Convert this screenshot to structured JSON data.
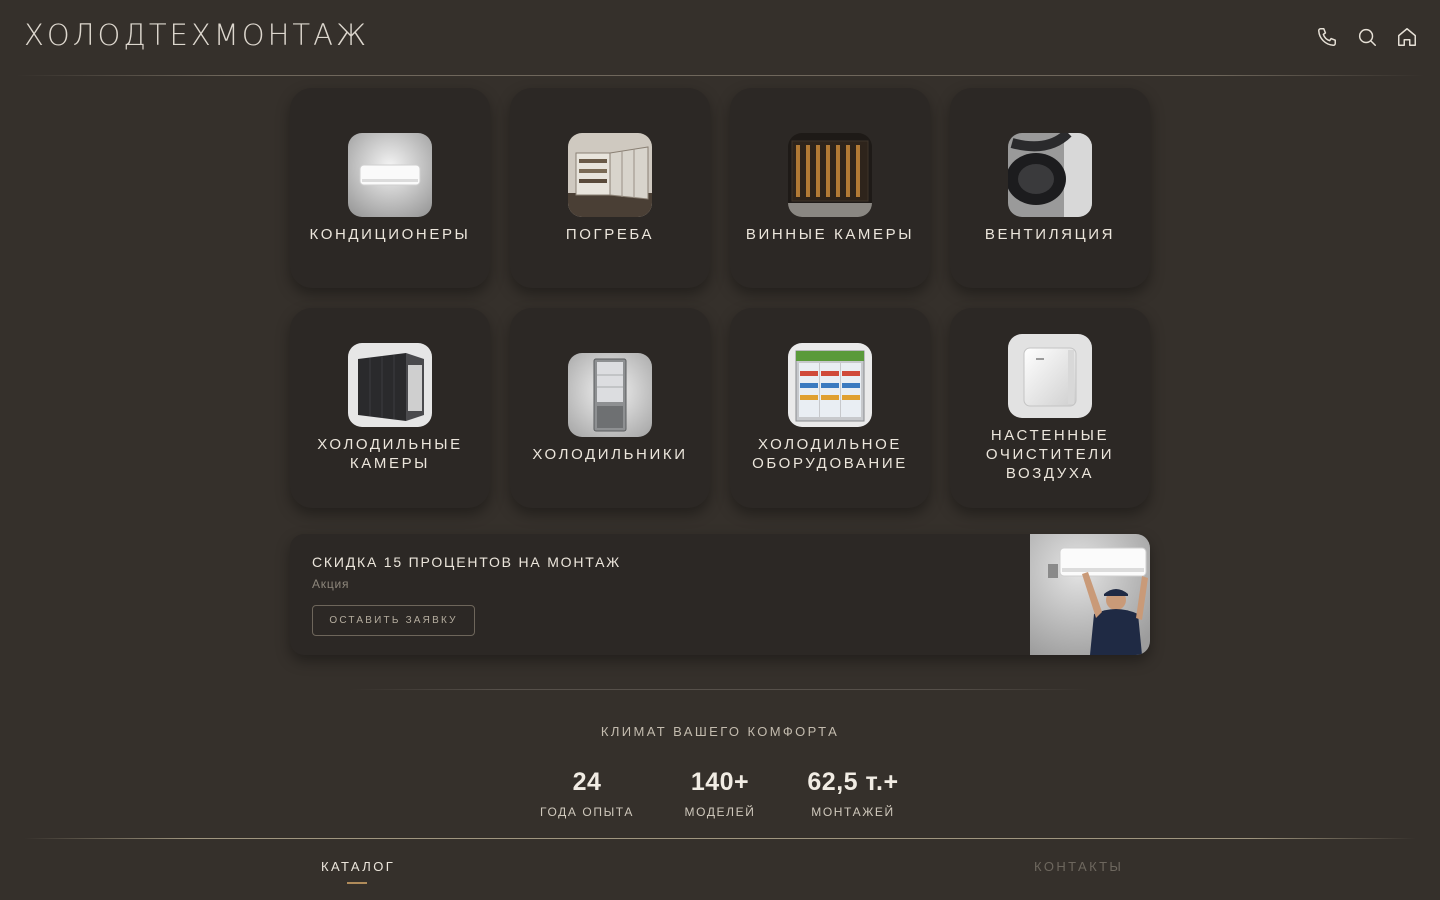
{
  "header": {
    "logo": "ХОЛОДТЕХМОНТАЖ",
    "icons": [
      "phone-icon",
      "search-icon",
      "home-icon"
    ]
  },
  "categories": [
    {
      "label": "КОНДИЦИОНЕРЫ"
    },
    {
      "label": "ПОГРЕБА"
    },
    {
      "label": "ВИННЫЕ КАМЕРЫ"
    },
    {
      "label": "ВЕНТИЛЯЦИЯ"
    },
    {
      "label": "ХОЛОДИЛЬНЫЕ КАМЕРЫ"
    },
    {
      "label": "ХОЛОДИЛЬНИКИ"
    },
    {
      "label": "ХОЛОДИЛЬНОЕ ОБОРУДОВАНИЕ"
    },
    {
      "label": "НАСТЕННЫЕ ОЧИСТИТЕЛИ ВОЗДУХА"
    }
  ],
  "promo": {
    "title": "СКИДКА 15 ПРОЦЕНТОВ НА МОНТАЖ",
    "subtitle": "Акция",
    "button": "ОСТАВИТЬ ЗАЯВКУ"
  },
  "slogan": "КЛИМАТ ВАШЕГО КОМФОРТА",
  "stats": [
    {
      "value": "24",
      "label": "ГОДА ОПЫТА"
    },
    {
      "value": "140+",
      "label": "МОДЕЛЕЙ"
    },
    {
      "value": "62,5 т.+",
      "label": "МОНТАЖЕЙ"
    }
  ],
  "bottom_nav": {
    "catalog": "КАТАЛОГ",
    "contacts": "КОНТАКТЫ",
    "active": "catalog"
  },
  "colors": {
    "background": "#35302b",
    "card": "#2c2825",
    "accent": "#b08b5a"
  }
}
